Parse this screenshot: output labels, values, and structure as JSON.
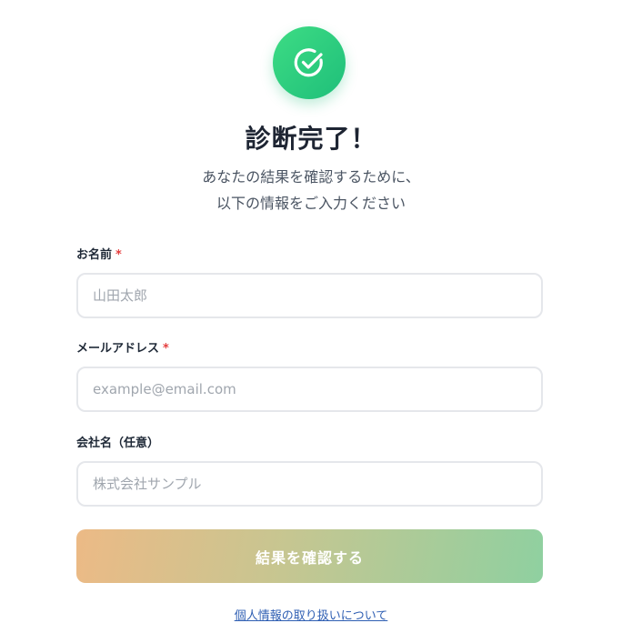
{
  "header": {
    "title": "診断完了！",
    "subtitle_line1": "あなたの結果を確認するために、",
    "subtitle_line2": "以下の情報をご入力ください",
    "badge_icon": "check-circle-icon",
    "accent_color": "#2ccf7e"
  },
  "form": {
    "name": {
      "label": "お名前",
      "required_mark": "*",
      "placeholder": "山田太郎",
      "value": ""
    },
    "email": {
      "label": "メールアドレス",
      "required_mark": "*",
      "placeholder": "example@email.com",
      "value": ""
    },
    "company": {
      "label": "会社名（任意）",
      "placeholder": "株式会社サンプル",
      "value": ""
    },
    "submit_label": "結果を確認する"
  },
  "footer": {
    "privacy_link": "個人情報の取り扱いについて"
  },
  "colors": {
    "required": "#e53e3e",
    "button_gradient_start": "#ecba86",
    "button_gradient_end": "#8fd0a0",
    "link": "#2f5fb3"
  }
}
